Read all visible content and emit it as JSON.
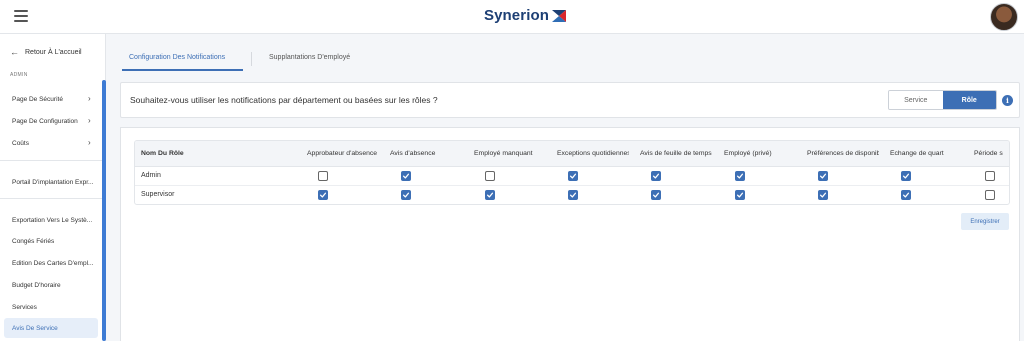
{
  "header": {
    "menu_icon": "hamburger-icon",
    "logo_text": "Synerion",
    "logo_colors": {
      "text": "#1d3f74",
      "mark_blue": "#1d3f74",
      "mark_red": "#d9262c"
    },
    "avatar_icon": "user-avatar"
  },
  "sidebar": {
    "back_label": "Retour À L'accueil",
    "section_label": "ADMIN",
    "group1": [
      {
        "label": "Page De Sécurité",
        "has_chevron": true
      },
      {
        "label": "Page De Configuration",
        "has_chevron": true
      },
      {
        "label": "Coûts",
        "has_chevron": true
      }
    ],
    "group2": [
      {
        "label": "Portail D'implantation Expr..."
      }
    ],
    "group3": [
      {
        "label": "Exportation Vers Le Systè..."
      },
      {
        "label": "Congés Fériés"
      },
      {
        "label": "Édition Des Cartes D'empl..."
      },
      {
        "label": "Budget D'horaire"
      },
      {
        "label": "Services"
      },
      {
        "label": "Avis De Service"
      }
    ],
    "active_item": "Avis De Service"
  },
  "tabs": [
    {
      "label": "Configuration Des Notifications",
      "active": true
    },
    {
      "label": "Supplantations D'employé",
      "active": false
    }
  ],
  "question": {
    "text": "Souhaitez-vous utiliser les notifications par département ou basées sur les rôles ?",
    "options": [
      "Service",
      "Rôle"
    ],
    "selected": "Rôle",
    "info_icon": "info-icon"
  },
  "table": {
    "columns": [
      "Nom Du Rôle",
      "Approbateur d'absence",
      "Avis d'absence",
      "Employé manquant",
      "Exceptions quotidiennes",
      "Avis de feuille de temps",
      "Employé (privé)",
      "Préférences de disponibilité",
      "Échange de quart",
      "Période s"
    ],
    "rows": [
      {
        "name": "Admin",
        "values": [
          false,
          true,
          false,
          true,
          true,
          true,
          true,
          true,
          false
        ]
      },
      {
        "name": "Supervisor",
        "values": [
          true,
          true,
          true,
          true,
          true,
          true,
          true,
          true,
          false
        ]
      }
    ]
  },
  "save_label": "Enregistrer",
  "colors": {
    "accent": "#3d6fb5",
    "sidebar_active_bg": "#e6eef9",
    "page_bg": "#f4f6f9"
  }
}
